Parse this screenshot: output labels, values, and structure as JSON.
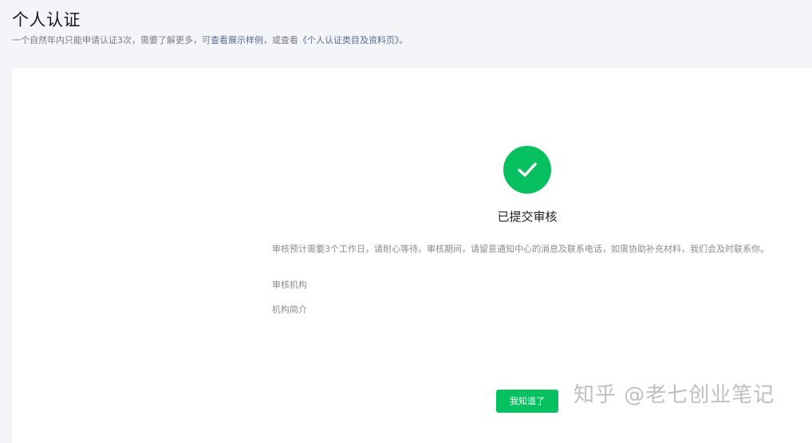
{
  "header": {
    "title": "个人认证",
    "subtitle_prefix": "一个自然年内只能申请认证3次，需要了解更多，可",
    "subtitle_link1": "查看展示样例",
    "subtitle_middle": "，或查看",
    "subtitle_link2": "《个人认证类目及资料页》",
    "subtitle_suffix": "。"
  },
  "result": {
    "icon": "check-icon",
    "title": "已提交审核",
    "notice": "审核预计需要3个工作日，请耐心等待。审核期间，请留意通知中心的消息及联系电话，如需协助补充材料，我们会及时联系你。",
    "labels": {
      "org": "审核机构",
      "intro": "机构简介"
    },
    "button_label": "我知道了"
  },
  "watermark": "知乎 @老七创业笔记",
  "colors": {
    "accent": "#07c160",
    "link": "#576b95",
    "background": "#f4f5f8"
  }
}
